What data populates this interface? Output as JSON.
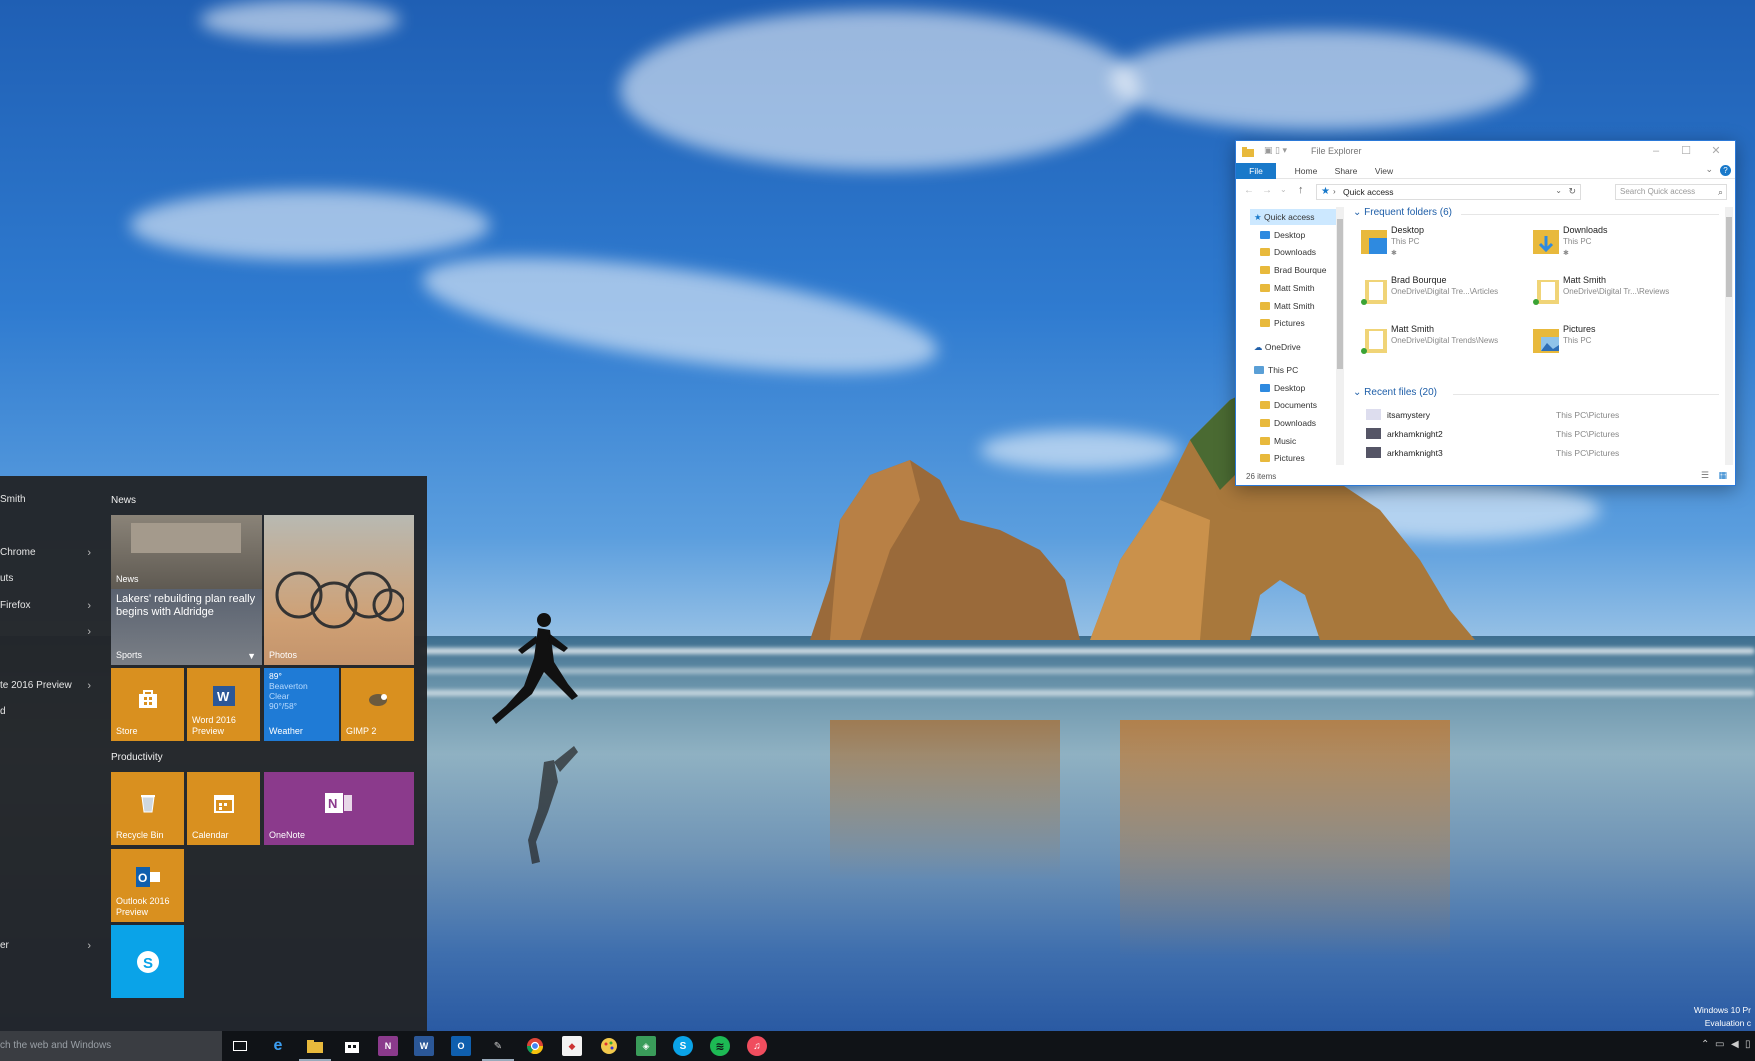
{
  "start_menu": {
    "user_name": "Smith",
    "app_list": [
      {
        "label": "Chrome",
        "has_arrow": true
      },
      {
        "label": "uts",
        "has_arrow": false
      },
      {
        "label": "Firefox",
        "has_arrow": true
      },
      {
        "label": "",
        "has_arrow": true
      },
      {
        "label": "te 2016 Preview",
        "has_arrow": true
      },
      {
        "label": "d",
        "has_arrow": false
      },
      {
        "label": "er",
        "has_arrow": true
      }
    ],
    "groups": {
      "news": "News",
      "productivity": "Productivity"
    },
    "tiles": {
      "news": {
        "label": "News"
      },
      "sports": {
        "headline": "Lakers' rebuilding plan really begins with Aldridge",
        "label": "Sports"
      },
      "photos": {
        "label": "Photos"
      },
      "store": {
        "label": "Store"
      },
      "word": {
        "label": "Word 2016 Preview"
      },
      "weather": {
        "temp": "89°",
        "city": "Beaverton",
        "condition": "Clear",
        "range": "90°/58°",
        "label": "Weather"
      },
      "gimp": {
        "label": "GIMP 2"
      },
      "recycle": {
        "label": "Recycle Bin"
      },
      "calendar": {
        "label": "Calendar"
      },
      "onenote": {
        "label": "OneNote"
      },
      "outlook": {
        "label": "Outlook 2016 Preview"
      },
      "skype": {
        "label": ""
      }
    }
  },
  "file_explorer": {
    "title": "File Explorer",
    "ribbon_tabs": [
      "File",
      "Home",
      "Share",
      "View"
    ],
    "address": "Quick access",
    "search_placeholder": "Search Quick access",
    "nav": {
      "quick_access": "Quick access",
      "quick_items": [
        "Desktop",
        "Downloads",
        "Brad Bourque",
        "Matt Smith",
        "Matt Smith",
        "Pictures"
      ],
      "onedrive": "OneDrive",
      "this_pc": "This PC",
      "pc_items": [
        "Desktop",
        "Documents",
        "Downloads",
        "Music",
        "Pictures"
      ]
    },
    "frequent_title": "Frequent folders (6)",
    "frequent_folders": [
      {
        "name": "Desktop",
        "path": "This PC"
      },
      {
        "name": "Downloads",
        "path": "This PC"
      },
      {
        "name": "Brad Bourque",
        "path": "OneDrive\\Digital Tre...\\Articles"
      },
      {
        "name": "Matt Smith",
        "path": "OneDrive\\Digital Tr...\\Reviews"
      },
      {
        "name": "Matt Smith",
        "path": "OneDrive\\Digital Trends\\News"
      },
      {
        "name": "Pictures",
        "path": "This PC"
      }
    ],
    "recent_title": "Recent files (20)",
    "recent_files": [
      {
        "name": "itsamystery",
        "path": "This PC\\Pictures"
      },
      {
        "name": "arkhamknight2",
        "path": "This PC\\Pictures"
      },
      {
        "name": "arkhamknight3",
        "path": "This PC\\Pictures"
      }
    ],
    "status": "26 items"
  },
  "taskbar": {
    "search_text": "ch the web and Windows",
    "watermark_line1": "Windows 10 Pr",
    "watermark_line2": "Evaluation c"
  },
  "colors": {
    "start_bg": "#222428",
    "tile_orange": "#d9901f",
    "tile_blue": "#1f7bd6",
    "tile_onenote": "#8b3a8c",
    "tile_skype": "#0aa3e8",
    "fe_accent": "#1979ca",
    "taskbar_bg": "#101317"
  }
}
